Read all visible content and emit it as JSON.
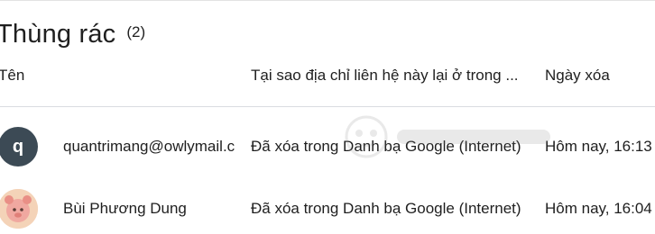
{
  "page": {
    "title": "Thùng rác",
    "count": "(2)"
  },
  "table": {
    "headers": {
      "name": "Tên",
      "reason": "Tại sao địa chỉ liên hệ này lại ở trong ...",
      "date": "Ngày xóa"
    },
    "rows": [
      {
        "avatar_letter": "q",
        "name": "quantrimang@owlymail.c",
        "reason": "Đã xóa trong Danh bạ Google (Internet)",
        "date": "Hôm nay, 16:13"
      },
      {
        "avatar_letter": "",
        "name": "Bùi Phương Dung",
        "reason": "Đã xóa trong Danh bạ Google (Internet)",
        "date": "Hôm nay, 16:04"
      }
    ]
  },
  "colors": {
    "avatar_dark": "#3c4a55",
    "divider": "#dadce0",
    "text": "#1f1f1f"
  }
}
